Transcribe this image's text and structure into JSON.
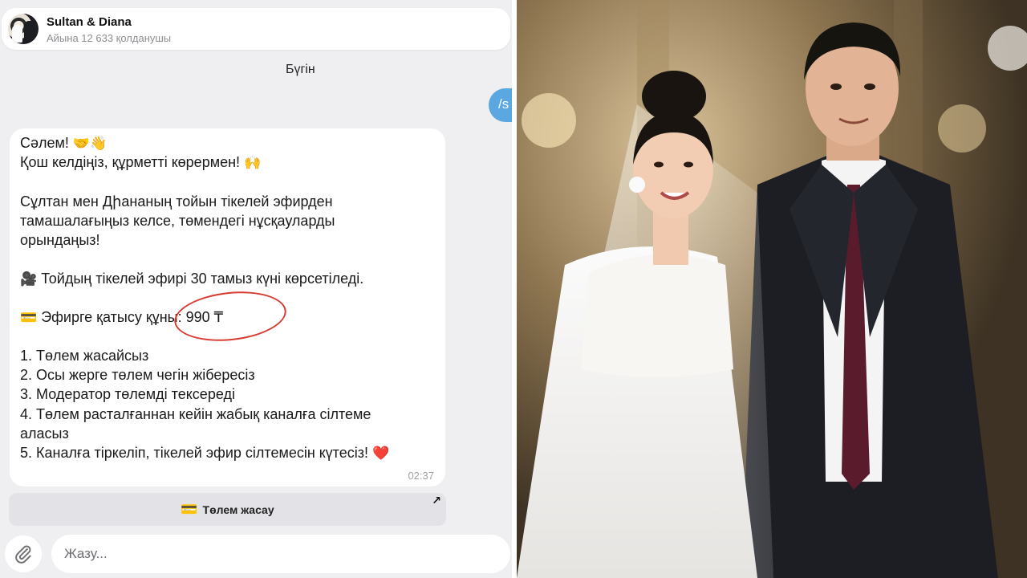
{
  "channel": {
    "name": "Sultan & Diana",
    "subscribers": "Айына 12 633 қолданушы"
  },
  "date_separator": "Бүгін",
  "sent_message_preview": "/s",
  "message": {
    "greeting": "Сәлем!",
    "greeting_emoji": "🤝👋",
    "welcome": "Қош келдіңіз, құрметті көрермен!",
    "welcome_emoji": "🙌",
    "intro_1": "Сұлтан мен Дիананың тойын тікелей эфирден",
    "intro_2": "тамашалағыңыз келсе, төмендегі нұсқауларды",
    "intro_3": "орындаңыз!",
    "broadcast_emoji": "🎥",
    "broadcast": "Тойдың тікелей эфирі 30 тамыз күні көрсетіледі.",
    "price_emoji": "💳",
    "price": "Эфирге қатысу құны: 990 ₸",
    "steps": [
      "1. Төлем жасайсыз",
      "2. Осы жерге төлем чегін жібересіз",
      "3. Модератор төлемді тексереді",
      "4. Төлем расталғаннан кейін жабық каналға сілтеме",
      "аласыз",
      "5. Каналға тіркеліп, тікелей эфир сілтемесін күтесіз!"
    ],
    "heart_emoji": "❤️",
    "time": "02:37"
  },
  "pay_button": {
    "icon": "💳",
    "label": "Төлем жасау"
  },
  "composer": {
    "placeholder": "Жазу..."
  },
  "colors": {
    "accent": "#5aa7e2",
    "highlight_circle": "#d93b32",
    "background": "#efeff2"
  },
  "icons": {
    "attach": "paperclip-icon",
    "open_link": "arrow-up-right-icon"
  }
}
